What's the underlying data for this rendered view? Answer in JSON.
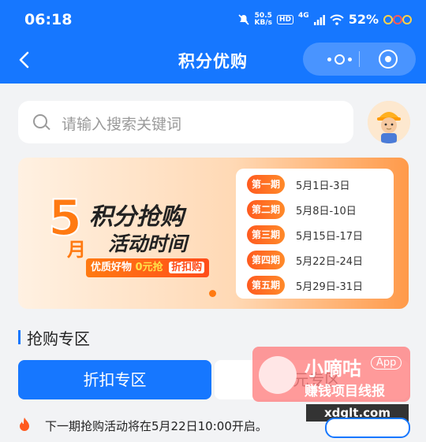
{
  "status_bar": {
    "time": "06:18",
    "net_speed_value": "50.5",
    "net_speed_unit": "KB/s",
    "hd": "HD",
    "signal": "4G",
    "battery": "52%"
  },
  "nav": {
    "title": "积分优购",
    "back_icon": "back-arrow-icon",
    "more_icon": "more-dots-icon",
    "close_icon": "target-circle-icon"
  },
  "search": {
    "placeholder": "请输入搜索关键词"
  },
  "banner": {
    "big_number": "5",
    "month": "月",
    "title_line1": "积分抢购",
    "title_line2": "活动时间",
    "tag_a": "优质好物",
    "tag_b": "0元抢",
    "tag_c": "折扣购",
    "periods": [
      {
        "label": "第一期",
        "date": "5月1日-3日"
      },
      {
        "label": "第二期",
        "date": "5月8日-10日"
      },
      {
        "label": "第三期",
        "date": "5月15日-17日"
      },
      {
        "label": "第四期",
        "date": "5月22日-24日"
      },
      {
        "label": "第五期",
        "date": "5月29日-31日"
      }
    ],
    "accent_color": "#ff7a12"
  },
  "section": {
    "title": "抢购专区",
    "tabs": [
      {
        "label": "折扣专区",
        "active": true
      },
      {
        "label": "0元专区",
        "active": false
      }
    ]
  },
  "notice": {
    "icon": "fire-icon",
    "text": "下一期抢购活动将在5月22日10:00开启。"
  },
  "watermark": {
    "name": "小嘀咕",
    "app": "App",
    "slogan": "赚钱项目线报",
    "url": "xdglt.com"
  },
  "colors": {
    "primary": "#1677ff",
    "background": "#f2f3f5"
  }
}
